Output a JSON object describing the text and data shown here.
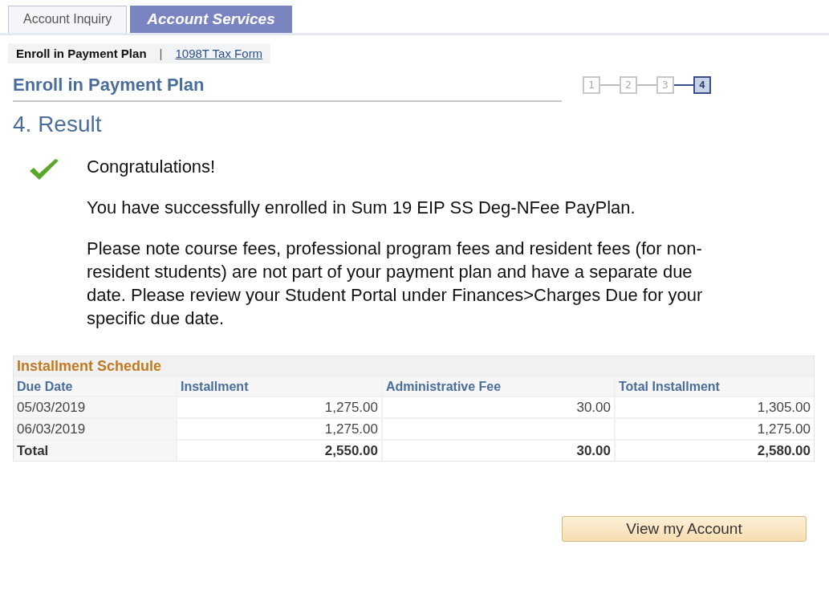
{
  "tabs": [
    {
      "label": "Account Inquiry",
      "selected": false
    },
    {
      "label": "Account Services",
      "selected": true
    }
  ],
  "subnav": {
    "items": [
      {
        "label": "Enroll in Payment Plan",
        "selected": true
      },
      {
        "label": "1098T Tax Form",
        "selected": false
      }
    ],
    "separator": "|"
  },
  "page_title": "Enroll in Payment Plan",
  "steps": [
    {
      "label": "1",
      "selected": false
    },
    {
      "label": "2",
      "selected": false
    },
    {
      "label": "3",
      "selected": false
    },
    {
      "label": "4",
      "selected": true
    }
  ],
  "section_title": "4. Result",
  "messages": [
    "Congratulations!",
    "You have successfully enrolled in Sum 19 EIP SS Deg-NFee PayPlan.",
    "Please note course fees, professional program fees and resident fees (for non-resident students) are not part of your payment plan and have a separate due date. Please review your Student Portal under Finances>Charges Due for your specific due date."
  ],
  "table": {
    "title": "Installment Schedule",
    "columns": [
      "Due Date",
      "Installment",
      "Administrative Fee",
      "Total Installment"
    ],
    "rows": [
      {
        "kind": "item",
        "cells": [
          "05/03/2019",
          "1,275.00",
          "30.00",
          "1,305.00"
        ]
      },
      {
        "kind": "item",
        "cells": [
          "06/03/2019",
          "1,275.00",
          "",
          "1,275.00"
        ]
      },
      {
        "kind": "total",
        "cells": [
          "Total",
          "2,550.00",
          "30.00",
          "2,580.00"
        ]
      }
    ]
  },
  "button": "View my Account"
}
